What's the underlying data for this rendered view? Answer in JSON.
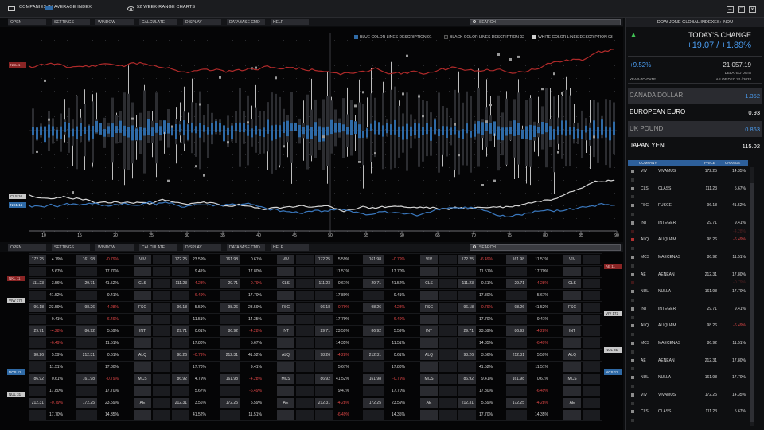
{
  "titlebar": {
    "title_part1": "COMPANIES IN",
    "title_part2": "AVERAGE INDEX",
    "tab2": "52 WEEK-RANGE CHARTS"
  },
  "menu": [
    "OPEN",
    "SETTINGS",
    "WINDOW",
    "CALCULATE",
    "DISPLAY",
    "DATABASE CMD",
    "HELP"
  ],
  "search": {
    "placeholder": "SEARCH"
  },
  "chart": {
    "legend": [
      {
        "label": "BLUE COLOR LINES DESCRIPTION 01",
        "color": "#2f6aa6"
      },
      {
        "label": "BLACK COLOR LINES DESCRIPTION 02",
        "color": "#111111"
      },
      {
        "label": "WHITE COLOR LINES DESCRIPTION 03",
        "color": "#cfcfcf"
      }
    ],
    "side_labels": {
      "red": "NKL 1",
      "white": "CLS 10",
      "blue": "NC1 16"
    },
    "x_ticks": [
      "10",
      "15",
      "20",
      "25",
      "30",
      "35",
      "40",
      "45",
      "50",
      "55",
      "60",
      "65",
      "70",
      "75",
      "80",
      "85",
      "90"
    ]
  },
  "grid": {
    "side_left": [
      "NKL 11",
      "VIW 172",
      "NCS 11",
      "NUL 31"
    ],
    "side_right": [
      "AE 11",
      "VIV 172",
      "NUL 31",
      "NCS 11"
    ],
    "blocks": [
      [
        [
          "172.25",
          "4.79%",
          "161.98",
          "-0.79%",
          "VIV"
        ],
        [
          "",
          "5.67%",
          "",
          "17.70%",
          ""
        ],
        [
          "111.23",
          "3.56%",
          "29.71",
          "41.52%",
          "CLS"
        ],
        [
          "",
          "41.52%",
          "",
          "9.41%",
          ""
        ],
        [
          "96.18",
          "23.59%",
          "98.26",
          "-4.28%",
          "FSC"
        ],
        [
          "",
          "9.41%",
          "",
          "-6.49%",
          ""
        ],
        [
          "29.71",
          "-4.28%",
          "86.92",
          "5.59%",
          "INT"
        ],
        [
          "",
          "-6.49%",
          "",
          "11.51%",
          ""
        ],
        [
          "98.26",
          "5.59%",
          "212.31",
          "0.61%",
          "ALQ"
        ],
        [
          "",
          "11.51%",
          "",
          "17.80%",
          ""
        ],
        [
          "86.92",
          "0.61%",
          "161.98",
          "-0.79%",
          "MCS"
        ],
        [
          "",
          "17.80%",
          "",
          "17.70%",
          ""
        ],
        [
          "212.31",
          "-0.79%",
          "172.25",
          "23.59%",
          "AE"
        ],
        [
          "",
          "17.70%",
          "",
          "14.35%",
          ""
        ]
      ],
      [
        [
          "172.25",
          "23.59%",
          "161.98",
          "0.61%",
          "VIV"
        ],
        [
          "",
          "9.41%",
          "",
          "17.80%",
          ""
        ],
        [
          "111.23",
          "-4.28%",
          "29.71",
          "-0.79%",
          "CLS"
        ],
        [
          "",
          "-6.49%",
          "",
          "17.70%",
          ""
        ],
        [
          "96.18",
          "5.59%",
          "98.26",
          "23.59%",
          "FSC"
        ],
        [
          "",
          "11.51%",
          "",
          "14.35%",
          ""
        ],
        [
          "29.71",
          "0.61%",
          "86.92",
          "-4.28%",
          "INT"
        ],
        [
          "",
          "17.80%",
          "",
          "5.67%",
          ""
        ],
        [
          "98.26",
          "-0.79%",
          "212.31",
          "41.52%",
          "ALQ"
        ],
        [
          "",
          "17.70%",
          "",
          "9.41%",
          ""
        ],
        [
          "86.92",
          "4.79%",
          "161.98",
          "-4.28%",
          "MCS"
        ],
        [
          "",
          "5.67%",
          "",
          "-6.49%",
          ""
        ],
        [
          "212.31",
          "3.56%",
          "172.25",
          "5.59%",
          "AE"
        ],
        [
          "",
          "41.52%",
          "",
          "11.51%",
          ""
        ]
      ],
      [
        [
          "172.25",
          "5.59%",
          "161.98",
          "-0.79%",
          "VIV"
        ],
        [
          "",
          "11.51%",
          "",
          "17.70%",
          ""
        ],
        [
          "111.23",
          "0.61%",
          "29.71",
          "41.52%",
          "CLS"
        ],
        [
          "",
          "17.80%",
          "",
          "9.41%",
          ""
        ],
        [
          "96.18",
          "-0.79%",
          "98.26",
          "-4.28%",
          "FSC"
        ],
        [
          "",
          "17.70%",
          "",
          "-6.49%",
          ""
        ],
        [
          "29.71",
          "23.59%",
          "86.92",
          "5.59%",
          "INT"
        ],
        [
          "",
          "14.35%",
          "",
          "11.51%",
          ""
        ],
        [
          "98.26",
          "-4.28%",
          "212.31",
          "0.61%",
          "ALQ"
        ],
        [
          "",
          "5.67%",
          "",
          "17.80%",
          ""
        ],
        [
          "86.92",
          "41.52%",
          "161.98",
          "-0.79%",
          "MCS"
        ],
        [
          "",
          "9.41%",
          "",
          "17.70%",
          ""
        ],
        [
          "212.31",
          "-4.28%",
          "172.25",
          "23.59%",
          "AE"
        ],
        [
          "",
          "-6.49%",
          "",
          "14.35%",
          ""
        ]
      ],
      [
        [
          "172.25",
          "-6.49%",
          "161.98",
          "11.51%",
          "VIV"
        ],
        [
          "",
          "11.51%",
          "",
          "17.70%",
          ""
        ],
        [
          "111.23",
          "0.61%",
          "29.71",
          "-4.28%",
          "CLS"
        ],
        [
          "",
          "17.80%",
          "",
          "5.67%",
          ""
        ],
        [
          "96.18",
          "-0.79%",
          "98.26",
          "41.52%",
          "FSC"
        ],
        [
          "",
          "17.70%",
          "",
          "9.41%",
          ""
        ],
        [
          "29.71",
          "23.59%",
          "86.92",
          "-4.28%",
          "INT"
        ],
        [
          "",
          "14.35%",
          "",
          "-6.49%",
          ""
        ],
        [
          "98.26",
          "3.56%",
          "212.31",
          "5.59%",
          "ALQ"
        ],
        [
          "",
          "41.52%",
          "",
          "11.51%",
          ""
        ],
        [
          "86.92",
          "9.41%",
          "161.98",
          "0.61%",
          "MCS"
        ],
        [
          "",
          "17.80%",
          "",
          "-6.49%",
          ""
        ],
        [
          "212.31",
          "5.59%",
          "172.25",
          "-4.28%",
          "AE"
        ],
        [
          "",
          "17.70%",
          "",
          "14.35%",
          ""
        ]
      ]
    ]
  },
  "panel": {
    "header": "DOW JONE GLOBAL INDEXES: INDU",
    "todays_change_label": "TODAY'S CHANGE",
    "todays_change_value": "+19.07 / +1.89%",
    "ytd_pct": "+9.52%",
    "ytd_value": "21,057.19",
    "delayed": "DELAYED DATA",
    "ytd_label": "YEAR-TO-DATE",
    "as_of": "AS OF DEC 20 / 2033",
    "currencies": [
      {
        "name": "CANADA DOLLAR",
        "value": "1.352",
        "name_color": "#9a9a9a",
        "value_color": "#4a9cf0",
        "bg": "#2a2b30"
      },
      {
        "name": "EUROPEAN EURO",
        "value": "0.93",
        "name_color": "#ffffff",
        "value_color": "#ffffff",
        "bg": "#0e0f11"
      },
      {
        "name": "UK POUND",
        "value": "0.863",
        "name_color": "#9a9a9a",
        "value_color": "#4a9cf0",
        "bg": "#2a2b30"
      },
      {
        "name": "JAPAN YEN",
        "value": "115.02",
        "name_color": "#ffffff",
        "value_color": "#ffffff",
        "bg": "#0e0f11"
      }
    ],
    "company_header": {
      "company": "COMPANY",
      "price": "PRICE",
      "change": "CHANGE"
    },
    "companies": [
      {
        "sym": "VIV",
        "name": "VIVAMUS",
        "price": "172.25",
        "change": "14.35%",
        "faded": false,
        "red": false
      },
      {
        "sym": "",
        "name": "",
        "price": "",
        "change": "",
        "faded": true,
        "red": false
      },
      {
        "sym": "CLS",
        "name": "CLASS",
        "price": "111.23",
        "change": "5.67%",
        "faded": false,
        "red": false
      },
      {
        "sym": "",
        "name": "",
        "price": "",
        "change": "",
        "faded": true,
        "red": false
      },
      {
        "sym": "FSC",
        "name": "FUSCE",
        "price": "96.18",
        "change": "41.52%",
        "faded": false,
        "red": false
      },
      {
        "sym": "",
        "name": "",
        "price": "",
        "change": "",
        "faded": true,
        "red": false
      },
      {
        "sym": "INT",
        "name": "INTEGER",
        "price": "29.71",
        "change": "9.41%",
        "faded": false,
        "red": false
      },
      {
        "sym": "",
        "name": "",
        "price": "",
        "change": "-4.28%",
        "faded": true,
        "red": true
      },
      {
        "sym": "ALQ",
        "name": "ALIQUAM",
        "price": "98.26",
        "change": "-6.49%",
        "faded": false,
        "red": true
      },
      {
        "sym": "",
        "name": "",
        "price": "",
        "change": "",
        "faded": true,
        "red": false
      },
      {
        "sym": "MCS",
        "name": "MAECENAS",
        "price": "86.92",
        "change": "11.51%",
        "faded": false,
        "red": false
      },
      {
        "sym": "",
        "name": "",
        "price": "",
        "change": "",
        "faded": true,
        "red": false
      },
      {
        "sym": "AE",
        "name": "AENEAN",
        "price": "212.31",
        "change": "17.80%",
        "faded": false,
        "red": false
      },
      {
        "sym": "",
        "name": "",
        "price": "",
        "change": "-0.79%",
        "faded": true,
        "red": true
      },
      {
        "sym": "NUL",
        "name": "NULLA",
        "price": "161.98",
        "change": "17.70%",
        "faded": false,
        "red": false
      },
      {
        "sym": "",
        "name": "",
        "price": "",
        "change": "",
        "faded": true,
        "red": false
      },
      {
        "sym": "INT",
        "name": "INTEGER",
        "price": "29.71",
        "change": "9.41%",
        "faded": false,
        "red": false
      },
      {
        "sym": "",
        "name": "",
        "price": "",
        "change": "",
        "faded": true,
        "red": false
      },
      {
        "sym": "ALQ",
        "name": "ALIQUAM",
        "price": "98.26",
        "change": "-6.49%",
        "faded": false,
        "red": false
      },
      {
        "sym": "",
        "name": "",
        "price": "",
        "change": "",
        "faded": true,
        "red": false
      },
      {
        "sym": "MCS",
        "name": "MAECENAS",
        "price": "86.92",
        "change": "11.51%",
        "faded": false,
        "red": false
      },
      {
        "sym": "",
        "name": "",
        "price": "",
        "change": "",
        "faded": true,
        "red": false
      },
      {
        "sym": "AE",
        "name": "AENEAN",
        "price": "212.31",
        "change": "17.80%",
        "faded": false,
        "red": false
      },
      {
        "sym": "",
        "name": "",
        "price": "",
        "change": "",
        "faded": true,
        "red": false
      },
      {
        "sym": "NUL",
        "name": "NULLA",
        "price": "161.98",
        "change": "17.70%",
        "faded": false,
        "red": false
      },
      {
        "sym": "",
        "name": "",
        "price": "",
        "change": "",
        "faded": true,
        "red": false
      },
      {
        "sym": "VIV",
        "name": "VIVAMUS",
        "price": "172.25",
        "change": "14.35%",
        "faded": false,
        "red": false
      },
      {
        "sym": "",
        "name": "",
        "price": "",
        "change": "",
        "faded": true,
        "red": false
      },
      {
        "sym": "CLS",
        "name": "CLASS",
        "price": "111.23",
        "change": "5.67%",
        "faded": false,
        "red": false
      },
      {
        "sym": "",
        "name": "",
        "price": "",
        "change": "",
        "faded": true,
        "red": false
      }
    ]
  }
}
